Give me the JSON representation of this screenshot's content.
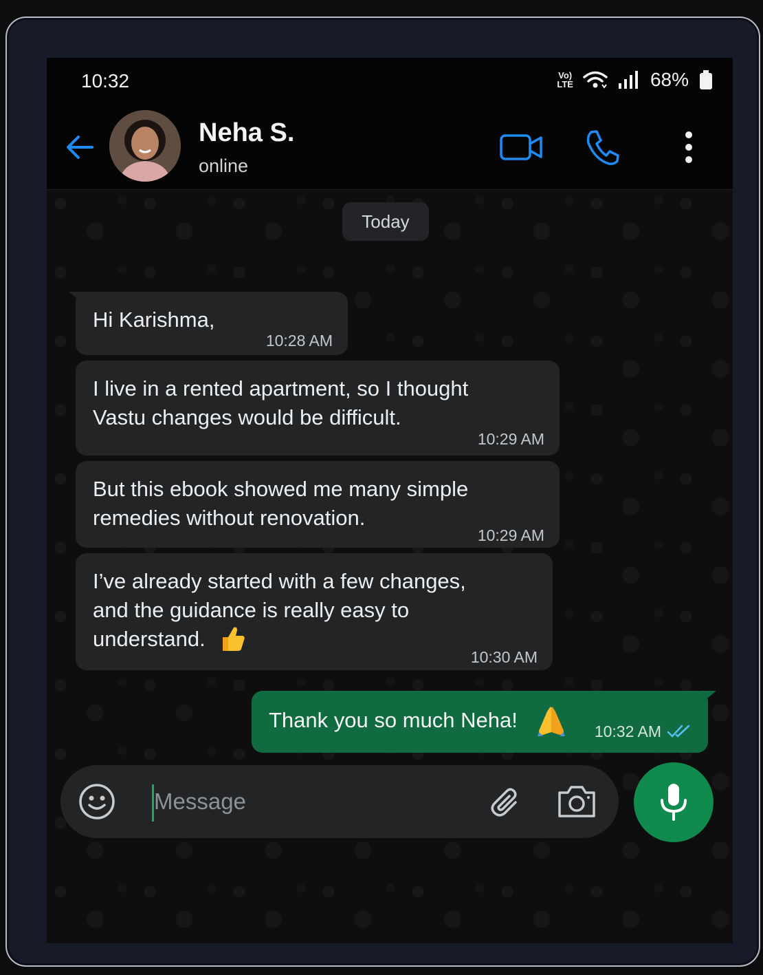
{
  "status_bar": {
    "time": "10:32",
    "network_top": "Vo)",
    "network_bottom": "LTE",
    "battery": "68%"
  },
  "header": {
    "contact_name": "Neha S.",
    "contact_status": "online"
  },
  "chat": {
    "date_label": "Today",
    "messages": [
      {
        "direction": "incoming",
        "text": "Hi Karishma,",
        "time": "10:28 AM"
      },
      {
        "direction": "incoming",
        "text": "I live in a rented apartment, so I thought\nVastu changes would be difficult.",
        "time": "10:29 AM"
      },
      {
        "direction": "incoming",
        "text": "But this ebook showed me many simple\nremedies without renovation.",
        "time": "10:29 AM"
      },
      {
        "direction": "incoming",
        "text": " I’ve already started with a few changes,\nand the guidance is really easy to\nunderstand.",
        "time": "10:30 AM",
        "emoji": "thumbs-up"
      },
      {
        "direction": "outgoing",
        "text": "Thank you so much Neha!",
        "time": "10:32 AM",
        "emoji": "folded-hands",
        "read": true
      }
    ]
  },
  "composer": {
    "placeholder": "Message",
    "value": ""
  },
  "colors": {
    "accent_blue": "#1f8cf5",
    "outgoing_bubble": "#106b41",
    "incoming_bubble": "#232426",
    "mic_button": "#118a4d",
    "read_ticks": "#53bdeb"
  },
  "icons": [
    "back-arrow-icon",
    "video-call-icon",
    "phone-icon",
    "more-options-icon",
    "emoji-icon",
    "attach-icon",
    "camera-icon",
    "mic-icon",
    "wifi-icon",
    "signal-icon",
    "battery-icon",
    "double-check-icon"
  ]
}
